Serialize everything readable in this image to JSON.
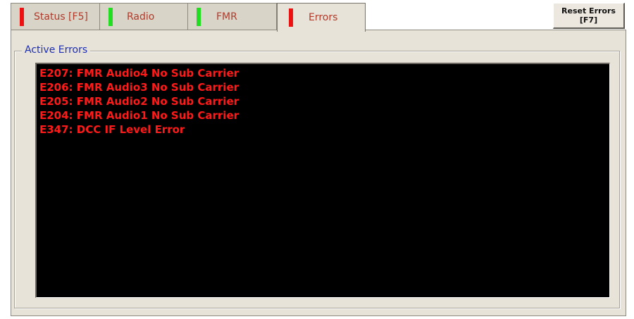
{
  "tabs": [
    {
      "label": "Status [F5]",
      "indicator_color": "#ee1111",
      "active": false
    },
    {
      "label": "Radio",
      "indicator_color": "#22dd22",
      "active": false
    },
    {
      "label": "FMR",
      "indicator_color": "#22dd22",
      "active": false
    },
    {
      "label": "Errors",
      "indicator_color": "#ee1111",
      "active": true
    }
  ],
  "reset_button": {
    "line1": "Reset Errors",
    "line2": "[F7]"
  },
  "group": {
    "title": "Active Errors"
  },
  "errors": [
    "E207: FMR Audio4 No Sub Carrier",
    "E206: FMR Audio3 No Sub Carrier",
    "E205: FMR Audio2 No Sub Carrier",
    "E204: FMR Audio1 No Sub Carrier",
    "E347: DCC IF Level Error"
  ],
  "colors": {
    "error_text": "#ff1a1a",
    "list_bg": "#000000",
    "group_title": "#1e2fb0"
  }
}
